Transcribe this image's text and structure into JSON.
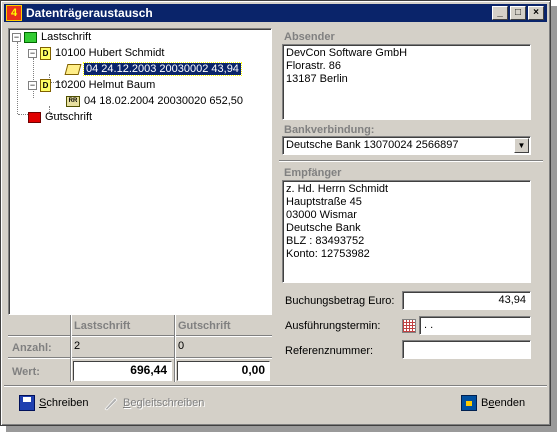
{
  "window": {
    "title": "Datenträgeraustausch",
    "app_icon_glyph": "4",
    "controls": {
      "minimize": "_",
      "maximize": "□",
      "close": "×"
    }
  },
  "tree": {
    "lastschrift_label": "Lastschrift",
    "customer1_label": "10100 Hubert Schmidt",
    "customer1_entry": "04 24.12.2003 20030002 43,94",
    "customer2_label": "10200 Helmut Baum",
    "customer2_entry": "04 18.02.2004 20030020 652,50",
    "gutschrift_label": "Gutschrift",
    "icon_d": "D",
    "icon_rr": "RR",
    "expand_glyph": "−"
  },
  "summary": {
    "col_lastschrift": "Lastschrift",
    "col_gutschrift": "Gutschrift",
    "anzahl_label": "Anzahl:",
    "anzahl_lastschrift": "2",
    "anzahl_gutschrift": "0",
    "wert_label": "Wert:",
    "wert_lastschrift": "696,44",
    "wert_gutschrift": "0,00"
  },
  "absender": {
    "label": "Absender",
    "line1": "DevCon Software GmbH",
    "line2": "Florastr. 86",
    "line3": "13187 Berlin"
  },
  "bank": {
    "label": "Bankverbindung:",
    "value": "Deutsche Bank 13070024 2566897",
    "dropdown_glyph": "▼"
  },
  "empfaenger": {
    "label": "Empfänger",
    "line1": "z. Hd. Herrn Schmidt",
    "line2": "Hauptstraße 45",
    "line3": "03000 Wismar",
    "line4": "Deutsche Bank",
    "line5": "BLZ  : 83493752",
    "line6": "Konto: 12753982"
  },
  "fields": {
    "buchungsbetrag_label": "Buchungsbetrag Euro:",
    "buchungsbetrag_value": "43,94",
    "ausfuehrung_label": "Ausführungstermin:",
    "ausfuehrung_value": ". .",
    "referenz_label": "Referenznummer:",
    "referenz_value": ""
  },
  "toolbar": {
    "schreiben_accel": "S",
    "schreiben_rest": "chreiben",
    "begleit_accel": "B",
    "begleit_rest": "egleitschreiben",
    "beenden_pre": "B",
    "beenden_accel": "e",
    "beenden_rest": "enden"
  }
}
